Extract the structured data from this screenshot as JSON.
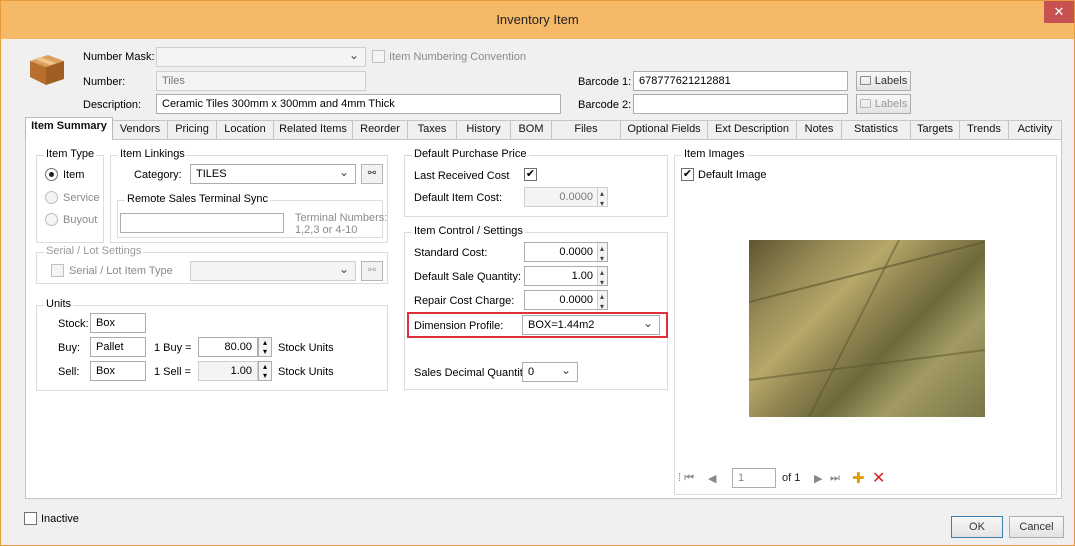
{
  "window": {
    "title": "Inventory Item",
    "close_glyph": "✕"
  },
  "header": {
    "number_mask_label": "Number Mask:",
    "number_mask_value": "",
    "item_numbering_label": "Item Numbering Convention",
    "number_label": "Number:",
    "number_value": "Tiles",
    "description_label": "Description:",
    "description_value": "Ceramic Tiles 300mm x 300mm and 4mm Thick",
    "barcode1_label": "Barcode 1:",
    "barcode1_value": "678777621212881",
    "barcode2_label": "Barcode 2:",
    "barcode2_value": "",
    "labels_button": "Labels",
    "labels_button2": "Labels"
  },
  "tabs": [
    "Item Summary",
    "Vendors",
    "Pricing",
    "Location",
    "Related Items",
    "Reorder",
    "Taxes",
    "History",
    "BOM",
    "Files",
    "Optional Fields",
    "Ext Description",
    "Notes",
    "Statistics",
    "Targets",
    "Trends",
    "Activity"
  ],
  "item_type": {
    "legend": "Item Type",
    "options": [
      "Item",
      "Service",
      "Buyout"
    ],
    "selected": "Item"
  },
  "item_linkings": {
    "legend": "Item Linkings",
    "category_label": "Category:",
    "category_value": "TILES"
  },
  "remote_sync": {
    "legend": "Remote Sales Terminal Sync",
    "input_value": "",
    "hint_line1": "Terminal Numbers:",
    "hint_line2": "1,2,3 or 4-10"
  },
  "serial_lot": {
    "legend": "Serial / Lot Settings",
    "checkbox_label": "Serial / Lot Item Type",
    "value": ""
  },
  "units": {
    "legend": "Units",
    "stock_label": "Stock:",
    "stock_value": "Box",
    "buy_label": "Buy:",
    "buy_value": "Pallet",
    "buy_eq": "1 Buy =",
    "buy_qty": "80.00",
    "buy_units": "Stock Units",
    "sell_label": "Sell:",
    "sell_value": "Box",
    "sell_eq": "1 Sell =",
    "sell_qty": "1.00",
    "sell_units": "Stock Units"
  },
  "default_purchase": {
    "legend": "Default Purchase Price",
    "last_received_label": "Last Received Cost",
    "last_received_checked": "✔",
    "default_cost_label": "Default Item Cost:",
    "default_cost_value": "0.0000"
  },
  "item_control": {
    "legend": "Item Control / Settings",
    "standard_cost_label": "Standard Cost:",
    "standard_cost_value": "0.0000",
    "sale_qty_label": "Default Sale Quantity:",
    "sale_qty_value": "1.00",
    "repair_label": "Repair Cost Charge:",
    "repair_value": "0.0000",
    "dimension_label": "Dimension Profile:",
    "dimension_value": "BOX=1.44m2",
    "decimal_label": "Sales Decimal Quantity:",
    "decimal_value": "0"
  },
  "images": {
    "legend": "Item Images",
    "default_label": "Default Image",
    "default_checked": "✔",
    "page_value": "1",
    "page_of": "of 1"
  },
  "footer": {
    "inactive_label": "Inactive",
    "ok": "OK",
    "cancel": "Cancel"
  }
}
